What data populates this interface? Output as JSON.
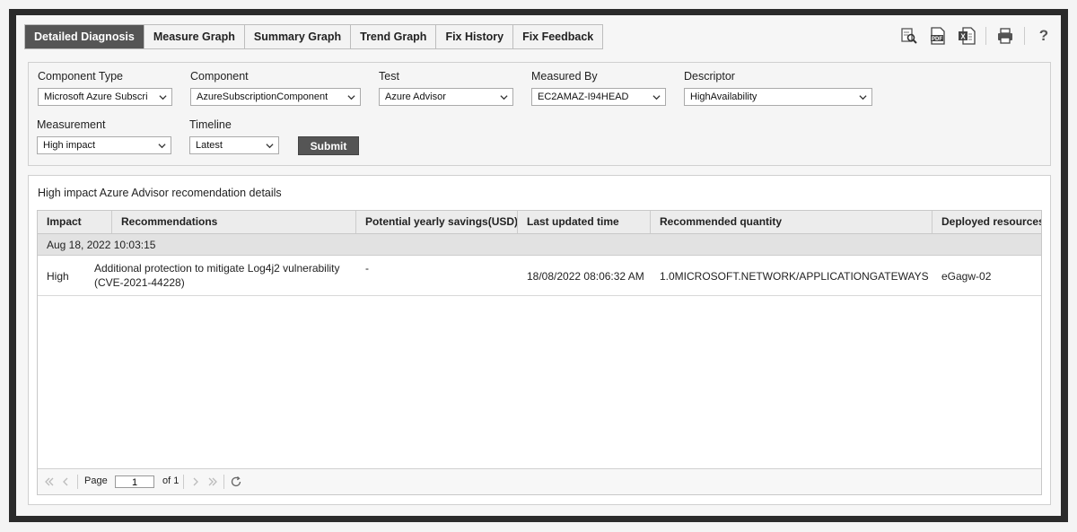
{
  "tabs": [
    {
      "label": "Detailed Diagnosis",
      "active": true
    },
    {
      "label": "Measure Graph",
      "active": false
    },
    {
      "label": "Summary Graph",
      "active": false
    },
    {
      "label": "Trend Graph",
      "active": false
    },
    {
      "label": "Fix History",
      "active": false
    },
    {
      "label": "Fix Feedback",
      "active": false
    }
  ],
  "toolbar": {
    "icons": [
      "search-report-icon",
      "pdf-icon",
      "excel-icon",
      "print-icon",
      "help-icon"
    ],
    "help_glyph": "?",
    "pdf_text": "PDF",
    "excel_text": "X"
  },
  "filters": {
    "component_type": {
      "label": "Component Type",
      "value": "Microsoft Azure Subscri"
    },
    "component": {
      "label": "Component",
      "value": "AzureSubscriptionComponent"
    },
    "test": {
      "label": "Test",
      "value": "Azure Advisor"
    },
    "measured_by": {
      "label": "Measured By",
      "value": "EC2AMAZ-I94HEAD"
    },
    "descriptor": {
      "label": "Descriptor",
      "value": "HighAvailability"
    },
    "measurement": {
      "label": "Measurement",
      "value": "High impact"
    },
    "timeline": {
      "label": "Timeline",
      "value": "Latest"
    },
    "submit_label": "Submit"
  },
  "results": {
    "title": "High impact Azure Advisor recomendation details",
    "columns": [
      "Impact",
      "Recommendations",
      "Potential yearly savings(USD)",
      "Last updated time",
      "Recommended quantity",
      "Deployed resources"
    ],
    "group_label": "Aug 18, 2022 10:03:15",
    "rows": [
      {
        "impact": "High",
        "recommendation_line1": "Additional protection to mitigate Log4j2 vulnerability",
        "recommendation_line2": "(CVE-2021-44228)",
        "savings": "-",
        "last_updated": "18/08/2022 08:06:32 AM",
        "quantity": "1.0MICROSOFT.NETWORK/APPLICATIONGATEWAYS",
        "deployed": "eGagw-02"
      }
    ]
  },
  "pager": {
    "page_label": "Page",
    "page_value": "1",
    "of_label": "of 1"
  }
}
